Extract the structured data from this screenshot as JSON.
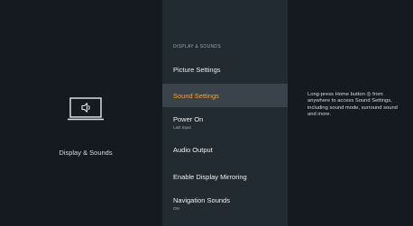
{
  "category": {
    "title": "Display & Sounds",
    "icon": "tv-speaker-icon"
  },
  "menu": {
    "heading": "DISPLAY & SOUNDS",
    "items": [
      {
        "label": "Picture Settings",
        "sublabel": "",
        "selected": false
      },
      {
        "label": "Sound Settings",
        "sublabel": "",
        "selected": true
      },
      {
        "label": "Power On",
        "sublabel": "Last Input",
        "selected": false
      },
      {
        "label": "Audio Output",
        "sublabel": "",
        "selected": false
      },
      {
        "label": "Enable Display Mirroring",
        "sublabel": "",
        "selected": false
      },
      {
        "label": "Navigation Sounds",
        "sublabel": "ON",
        "selected": false
      }
    ]
  },
  "help": {
    "text": "Long-press Home button ◎ from anywhere to access Sound Settings, including sound mode, surround sound and more."
  },
  "colors": {
    "background": "#141a1f",
    "menu_background": "#232b32",
    "selected_background": "#3a434b",
    "accent": "#f7a325"
  }
}
